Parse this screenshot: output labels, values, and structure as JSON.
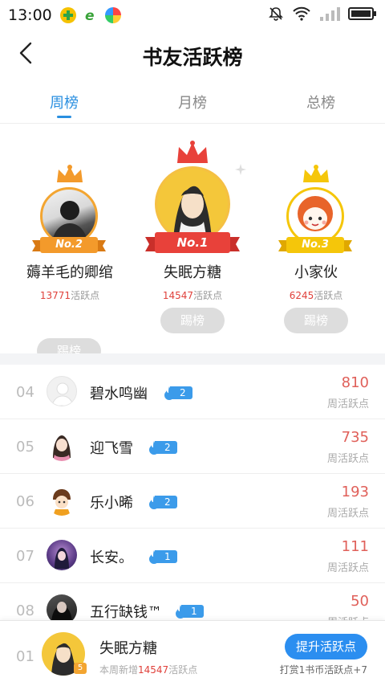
{
  "status_bar": {
    "time": "13:00"
  },
  "header": {
    "title": "书友活跃榜"
  },
  "tabs": [
    {
      "label": "周榜",
      "active": true
    },
    {
      "label": "月榜",
      "active": false
    },
    {
      "label": "总榜",
      "active": false
    }
  ],
  "podium": {
    "first": {
      "badge": "No.1",
      "name": "失眠方糖",
      "points": "14547",
      "points_unit": "活跃点",
      "button": "踢榜"
    },
    "second": {
      "badge": "No.2",
      "name": "薅羊毛的卿绾",
      "points": "13771",
      "points_unit": "活跃点",
      "button": "踢榜"
    },
    "third": {
      "badge": "No.3",
      "name": "小家伙",
      "points": "6245",
      "points_unit": "活跃点",
      "button": "踢榜"
    }
  },
  "list": [
    {
      "rank": "04",
      "name": "碧水鸣幽",
      "level": "2",
      "score": "810",
      "score_label": "周活跃点"
    },
    {
      "rank": "05",
      "name": "迎飞雪",
      "level": "2",
      "score": "735",
      "score_label": "周活跃点"
    },
    {
      "rank": "06",
      "name": "乐小晞",
      "level": "2",
      "score": "193",
      "score_label": "周活跃点"
    },
    {
      "rank": "07",
      "name": "长安。",
      "level": "1",
      "score": "111",
      "score_label": "周活跃点"
    },
    {
      "rank": "08",
      "name": "五行缺钱™",
      "level": "1",
      "score": "50",
      "score_label": "周活跃点"
    }
  ],
  "my_rank": {
    "rank": "01",
    "name": "失眠方糖",
    "level": "5",
    "sub_prefix": "本周新增",
    "sub_points": "14547",
    "sub_suffix": "活跃点",
    "button": "提升活跃点",
    "tip": "打赏1书币活跃点+7"
  },
  "colors": {
    "accent": "#2a8fe0",
    "red": "#e0413b",
    "gold": "#f3a531"
  }
}
